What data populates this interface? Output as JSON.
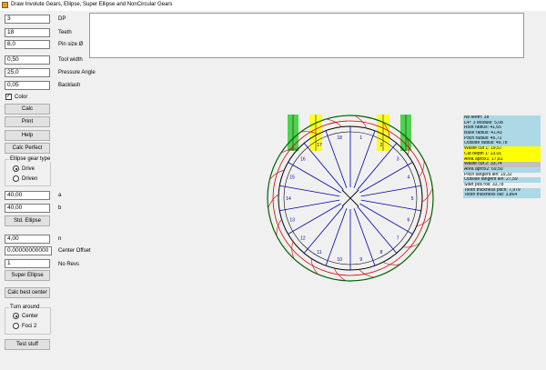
{
  "window": {
    "title": "Draw Involute Gears, Ellipse, Super Ellipse and NonCircular Gears"
  },
  "fields": [
    {
      "value": "3",
      "label": "DP"
    },
    {
      "value": "18",
      "label": "Teeth"
    },
    {
      "value": "8,0",
      "label": "Pin size Ø"
    },
    {
      "value": "0,50",
      "label": "Tool width"
    },
    {
      "value": "25,0",
      "label": "Pressure Angle"
    },
    {
      "value": "0,05",
      "label": "Backlash"
    }
  ],
  "color_checkbox": {
    "label": "Color",
    "checked": true,
    "mark": "✓"
  },
  "buttons": {
    "calc": "Calc",
    "print": "Print",
    "help": "Help",
    "calc_perfect": "Calc Perfect",
    "std_ellipse": "Std. Ellipse",
    "super_ellipse": "Super Ellipse",
    "calc_best_center": "Calc best center",
    "test_stuff": "Test stuff"
  },
  "ellipse_group": {
    "title": "Ellipse gear type",
    "options": [
      "Drive",
      "Driven"
    ],
    "selected": "Drive"
  },
  "ellipse_fields": [
    {
      "value": "40,00",
      "label": "a"
    },
    {
      "value": "40,00",
      "label": "b"
    }
  ],
  "super_fields": [
    {
      "value": "4,00",
      "label": "n"
    },
    {
      "value": "0,00000000000",
      "label": "Center Offset"
    },
    {
      "value": "1",
      "label": "No Revs"
    }
  ],
  "turn_group": {
    "title": "Turn around",
    "options": [
      "Center",
      "Foci 2"
    ],
    "selected": "Center"
  },
  "info_lines": [
    {
      "text": "No teeth: 18",
      "bg": "#add8e6"
    },
    {
      "text": "DP: 3 Module: 5,08",
      "bg": "#add8e6"
    },
    {
      "text": "Root radius: 41,65",
      "bg": "#add8e6"
    },
    {
      "text": "Base radius: 41,43",
      "bg": "#add8e6"
    },
    {
      "text": "Pitch radius: 45,72",
      "bg": "#add8e6"
    },
    {
      "text": "Outside radius: 49,78",
      "bg": "#add8e6"
    },
    {
      "text": "Waste cut 1: 19,57",
      "bg": "#ffff00"
    },
    {
      "text": "Cut depth 1: 13,01",
      "bg": "#ffff00"
    },
    {
      "text": "Area aprox1: 17,81",
      "bg": "#ffff00"
    },
    {
      "text": "Waste cut 2: 33,74",
      "bg": "#c0c0c0"
    },
    {
      "text": "Area aprox2: 69,50",
      "bg": "#add8e6"
    },
    {
      "text": "Pitch tangent len: 19,32",
      "bg": "#f0f0f0"
    },
    {
      "text": "Outside tangent len: 27,59",
      "bg": "#add8e6"
    },
    {
      "text": "Start pos roll: 33,78",
      "bg": "#f0f0f0"
    },
    {
      "text": "Tooth thickness pitch: 7,979",
      "bg": "#add8e6"
    },
    {
      "text": "Tooth thickness out: 3,864",
      "bg": "#add8e6"
    }
  ],
  "drawing": {
    "tooth_labels": [
      "1",
      "2",
      "3",
      "4",
      "5",
      "6",
      "7",
      "8",
      "9",
      "10",
      "11",
      "12",
      "13",
      "14",
      "15",
      "16",
      "17",
      "18"
    ],
    "colors": {
      "outside": "#006400",
      "pitch": "#cc0000",
      "root": "#000000",
      "spoke": "#0000aa",
      "green_bar": "#33cc33",
      "yellow_bar": "#ffff00"
    }
  }
}
